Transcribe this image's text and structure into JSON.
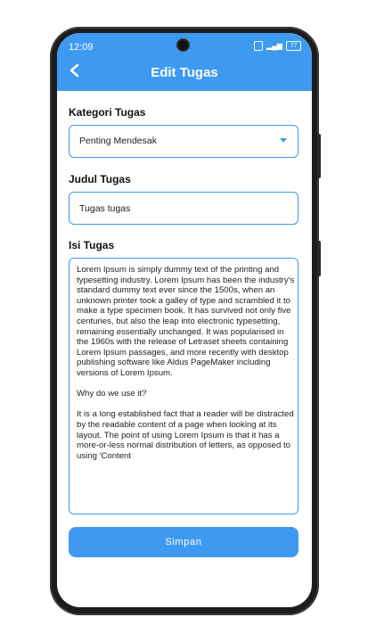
{
  "status": {
    "time": "12:09",
    "battery": "77"
  },
  "header": {
    "title": "Edit Tugas"
  },
  "form": {
    "category_label": "Kategori Tugas",
    "category_value": "Penting Mendesak",
    "title_label": "Judul Tugas",
    "title_value": "Tugas tugas",
    "content_label": "Isi Tugas",
    "content_value": "Lorem Ipsum is simply dummy text of the printing and typesetting industry. Lorem Ipsum has been the industry's standard dummy text ever since the 1500s, when an unknown printer took a galley of type and scrambled it to make a type specimen book. It has survived not only five centuries, but also the leap into electronic typesetting, remaining essentially unchanged. It was popularised in the 1960s with the release of Letraset sheets containing Lorem Ipsum passages, and more recently with desktop publishing software like Aldus PageMaker including versions of Lorem Ipsum.\n\nWhy do we use it?\n\nIt is a long established fact that a reader will be distracted by the readable content of a page when looking at its layout. The point of using Lorem Ipsum is that it has a more-or-less normal distribution of letters, as opposed to using 'Content",
    "save_label": "Simpan"
  },
  "icons": {
    "back": "back-arrow-icon",
    "dropdown": "chevron-down-icon"
  },
  "colors": {
    "accent": "#3d9af0"
  }
}
